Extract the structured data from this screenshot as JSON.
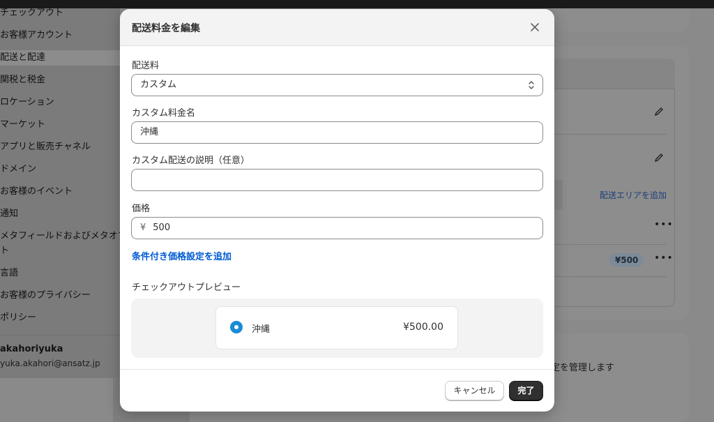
{
  "background": {
    "sidebar": {
      "items": [
        {
          "label": "チェックアウト"
        },
        {
          "label": "お客様アカウント"
        },
        {
          "label": "配送と配達"
        },
        {
          "label": "関税と税金"
        },
        {
          "label": "ロケーション"
        },
        {
          "label": "マーケット"
        },
        {
          "label": "アプリと販売チャネル"
        },
        {
          "label": "ドメイン"
        },
        {
          "label": "お客様のイベント"
        },
        {
          "label": "通知"
        },
        {
          "label": "メタフィールドおよびメタオブ"
        },
        {
          "label": "ト"
        },
        {
          "label": "言語"
        },
        {
          "label": "お客様のプライバシー"
        },
        {
          "label": "ポリシー"
        }
      ],
      "user_name": "akahoriyuka",
      "user_email": "yuka.akahori@ansatz.jp"
    },
    "right": {
      "add_area_link": "配送エリアを追加",
      "badge": "¥500",
      "manage_text": "定を管理します"
    }
  },
  "modal": {
    "title": "配送料金を編集",
    "rate_label": "配送料",
    "rate_value": "カスタム",
    "name_label": "カスタム料金名",
    "name_value": "沖縄",
    "desc_label": "カスタム配送の説明（任意）",
    "desc_value": "",
    "price_label": "価格",
    "currency": "¥",
    "price_value": "500",
    "add_condition_link": "条件付き価格設定を追加",
    "preview_label": "チェックアウトプレビュー",
    "preview_name": "沖縄",
    "preview_price": "¥500.00",
    "cancel_label": "キャンセル",
    "done_label": "完了"
  }
}
